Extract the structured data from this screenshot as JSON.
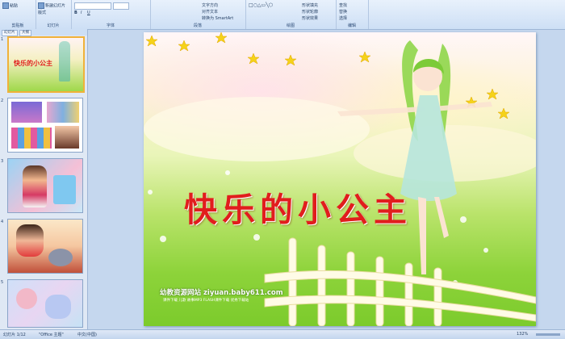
{
  "ribbon": {
    "groups": [
      "剪贴板",
      "幻灯片",
      "字体",
      "段落",
      "绘图",
      "编辑"
    ],
    "buttons": [
      "粘贴",
      "新建幻灯片",
      "版式",
      "重设",
      "删除",
      "文字方向",
      "对齐文本",
      "转换为 SmartArt",
      "形状填充",
      "形状轮廓",
      "形状效果",
      "查找",
      "替换",
      "选择"
    ]
  },
  "panel": {
    "tabs": [
      "幻灯片",
      "大纲"
    ],
    "thumbnails": [
      {
        "num": "1",
        "caption": "快乐的小公主"
      },
      {
        "num": "2",
        "caption": ""
      },
      {
        "num": "3",
        "caption": ""
      },
      {
        "num": "4",
        "caption": ""
      },
      {
        "num": "5",
        "caption": ""
      }
    ]
  },
  "slide": {
    "title": "快乐的小公主",
    "site": "幼教资源网站  ziyuan.baby611.com",
    "subsite": "课件下载  儿歌  故事MP3  FLASH课件下载  优秀下载站"
  },
  "status": {
    "slide_info": "幻灯片 1/12",
    "theme": "\"Office 主题\"",
    "language": "中文(中国)",
    "zoom": "132%"
  },
  "colors": {
    "title": "#e11d1d",
    "ribbon_bg": "#dce8f8",
    "panel_bg": "#dfe8f4"
  }
}
